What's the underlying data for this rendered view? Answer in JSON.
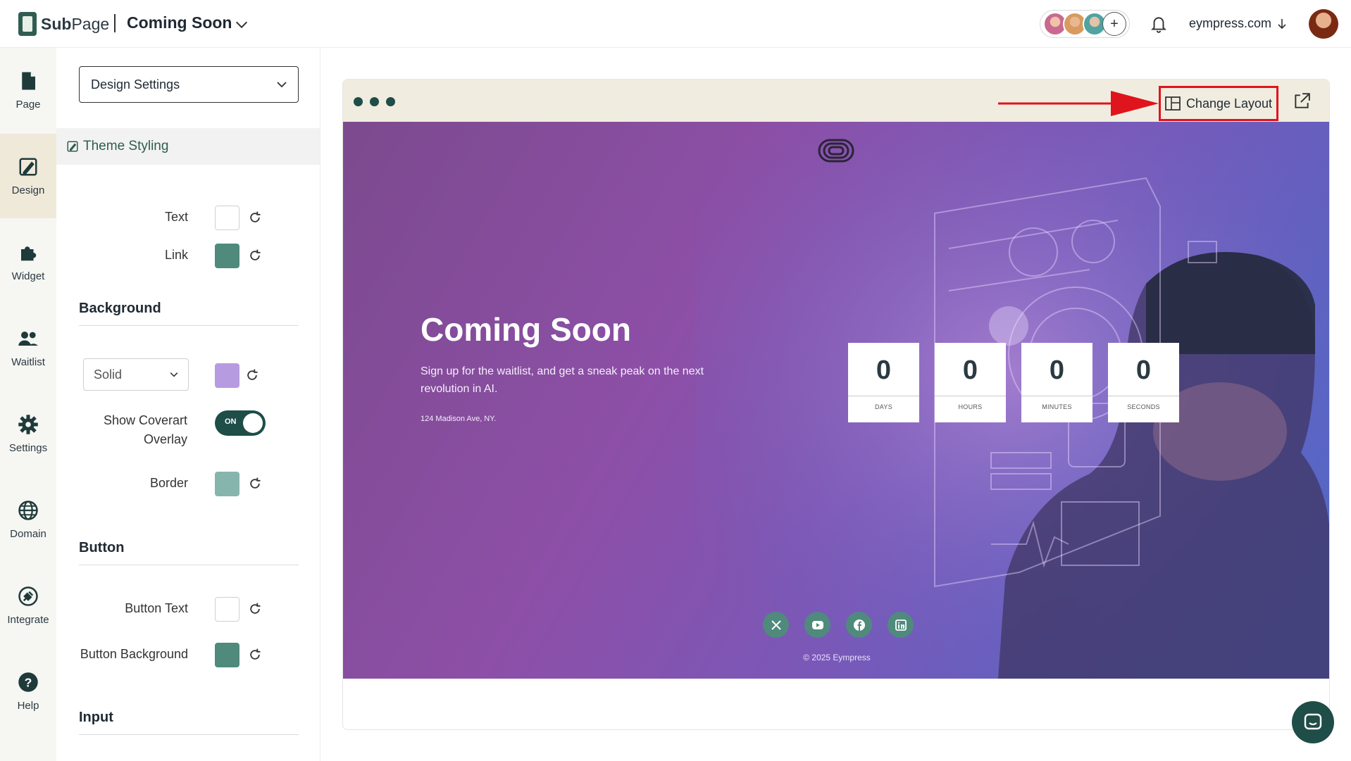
{
  "header": {
    "brand_sub": "Sub",
    "brand_page": "Page",
    "page_title": "Coming Soon",
    "domain": "eympress.com",
    "collaborator_colors": [
      "#c9698f",
      "#d89a5e",
      "#4fa3a1"
    ]
  },
  "rail": {
    "items": [
      {
        "label": "Page",
        "icon": "page-icon"
      },
      {
        "label": "Design",
        "icon": "design-icon",
        "active": true
      },
      {
        "label": "Widget",
        "icon": "puzzle-icon"
      },
      {
        "label": "Waitlist",
        "icon": "users-icon"
      },
      {
        "label": "Settings",
        "icon": "gear-icon"
      },
      {
        "label": "Domain",
        "icon": "globe-icon"
      },
      {
        "label": "Integrate",
        "icon": "plug-icon"
      },
      {
        "label": "Help",
        "icon": "help-icon"
      }
    ]
  },
  "panel": {
    "select_value": "Design Settings",
    "theme_label": "Theme Styling",
    "text_label": "Text",
    "text_color": "#ffffff",
    "link_label": "Link",
    "link_color": "#4f8a7d",
    "background_heading": "Background",
    "bg_type": "Solid",
    "bg_color": "#b79be0",
    "overlay_label_line1": "Show Coverart",
    "overlay_label_line2": "Overlay",
    "overlay_toggle": "ON",
    "border_label": "Border",
    "border_color": "#86b5ae",
    "button_heading": "Button",
    "button_text_label": "Button Text",
    "button_text_color": "#ffffff",
    "button_bg_label": "Button Background",
    "button_bg_color": "#4f8a7d",
    "input_heading": "Input"
  },
  "preview": {
    "change_layout_label": "Change Layout",
    "annotation_color": "#e0141c",
    "hero": {
      "title": "Coming Soon",
      "subtitle": "Sign up for the waitlist, and get a sneak peak on the next revolution in AI.",
      "address": "124 Madison Ave, NY.",
      "countdown": [
        {
          "value": "0",
          "unit": "DAYS"
        },
        {
          "value": "0",
          "unit": "HOURS"
        },
        {
          "value": "0",
          "unit": "MINUTES"
        },
        {
          "value": "0",
          "unit": "SECONDS"
        }
      ],
      "socials": [
        "x-icon",
        "youtube-icon",
        "facebook-icon",
        "linkedin-icon"
      ],
      "copyright": "© 2025 Eympress"
    }
  }
}
